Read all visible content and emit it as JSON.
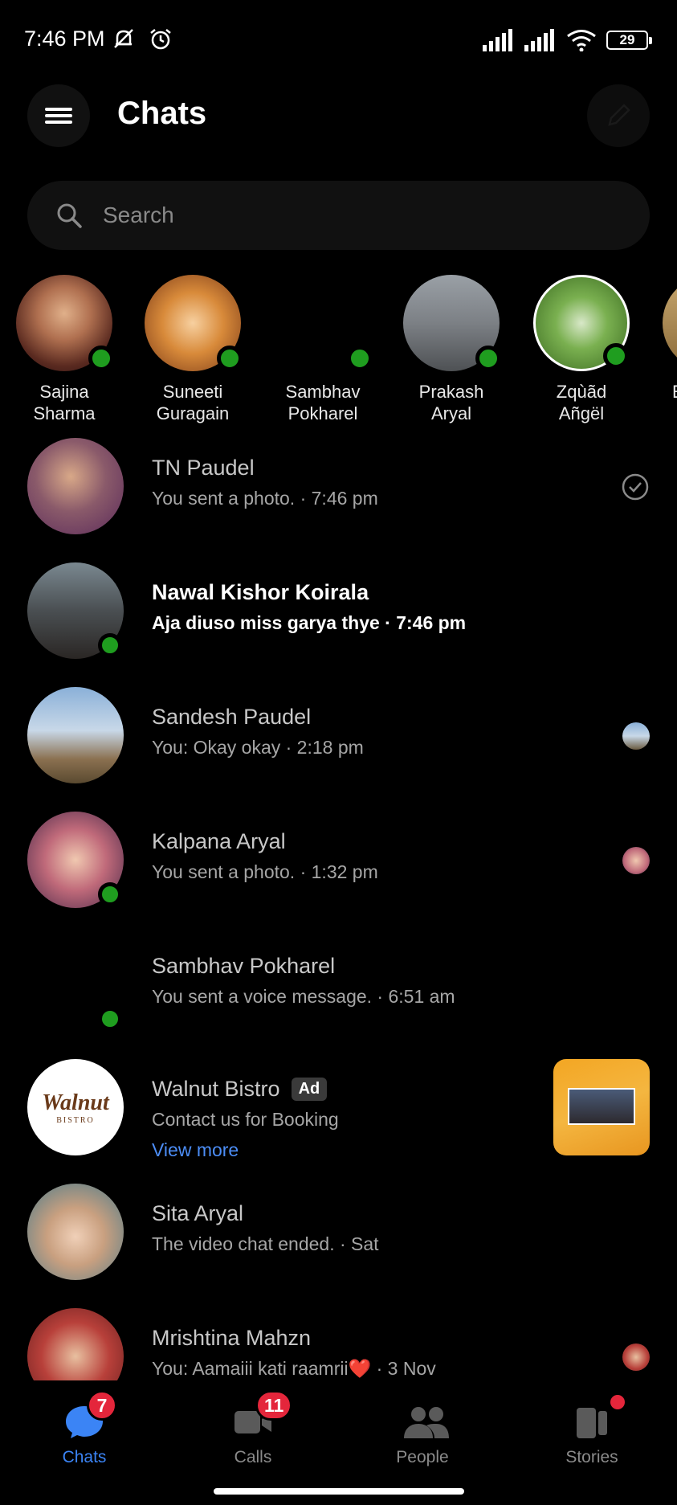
{
  "status_bar": {
    "time": "7:46 PM",
    "battery": "29"
  },
  "header": {
    "title": "Chats"
  },
  "search": {
    "placeholder": "Search"
  },
  "active_users": [
    {
      "name": "Sajina\nSharma",
      "avatar_color": "#7a3b2f",
      "online": true
    },
    {
      "name": "Suneeti\nGuragain Para...",
      "avatar_color": "#c47a2c",
      "online": true
    },
    {
      "name": "Sambhav\nPokharel",
      "avatar_color": "#000000",
      "online": true
    },
    {
      "name": "Prakash\nAryal",
      "avatar_color": "#6b6e70",
      "online": true
    },
    {
      "name": "Zqùãd\nAñgël",
      "avatar_color": "#4f8a3a",
      "online": true
    },
    {
      "name": "E",
      "avatar_color": "#a88a55",
      "online": false
    }
  ],
  "chats": [
    {
      "name": "TN Paudel",
      "preview": "You sent a photo. · 7:46 pm",
      "unread": false,
      "online": false,
      "avatar_color": "#8a4f8a",
      "status": "sent"
    },
    {
      "name": "Nawal Kishor Koirala",
      "preview": "Aja diuso miss garya thye · 7:46 pm",
      "unread": true,
      "online": true,
      "avatar_color": "#3d4448",
      "status": "none"
    },
    {
      "name": "Sandesh Paudel",
      "preview": "You: Okay okay · 2:18 pm",
      "unread": false,
      "online": false,
      "avatar_color": "#7aa0c8",
      "status": "seen"
    },
    {
      "name": "Kalpana Aryal",
      "preview": "You sent a photo. · 1:32 pm",
      "unread": false,
      "online": true,
      "avatar_color": "#c06a7a",
      "status": "seen"
    },
    {
      "name": "Sambhav Pokharel",
      "preview": "You sent a voice message. · 6:51 am",
      "unread": false,
      "online": true,
      "avatar_color": "#000000",
      "status": "none"
    },
    {
      "name": "Walnut Bistro",
      "ad_label": "Ad",
      "preview": "Contact us for Booking",
      "view_more": "View more",
      "unread": false,
      "online": false,
      "avatar_color": "#ffffff",
      "logo_text": "Walnut",
      "logo_sub": "BISTRO",
      "status": "ad"
    },
    {
      "name": "Sita Aryal",
      "preview": "The video chat ended. · Sat",
      "unread": false,
      "online": false,
      "avatar_color": "#c9a080",
      "status": "none"
    },
    {
      "name": "Mrishtina Mahzn",
      "preview": "You: Aamaiii kati raamrii❤️ · 3 Nov",
      "unread": false,
      "online": false,
      "avatar_color": "#b8403a",
      "status": "seen"
    }
  ],
  "bottom_nav": [
    {
      "label": "Chats",
      "badge": "7",
      "active": true,
      "icon": "chat-bubble-icon"
    },
    {
      "label": "Calls",
      "badge": "11",
      "active": false,
      "icon": "video-camera-icon"
    },
    {
      "label": "People",
      "badge": "",
      "active": false,
      "icon": "people-icon"
    },
    {
      "label": "Stories",
      "badge": "",
      "dot": true,
      "active": false,
      "icon": "stories-icon"
    }
  ],
  "colors": {
    "accent": "#3b84f5",
    "online": "#1f9d1f",
    "badge": "#e4263b",
    "link": "#4c8df6"
  }
}
